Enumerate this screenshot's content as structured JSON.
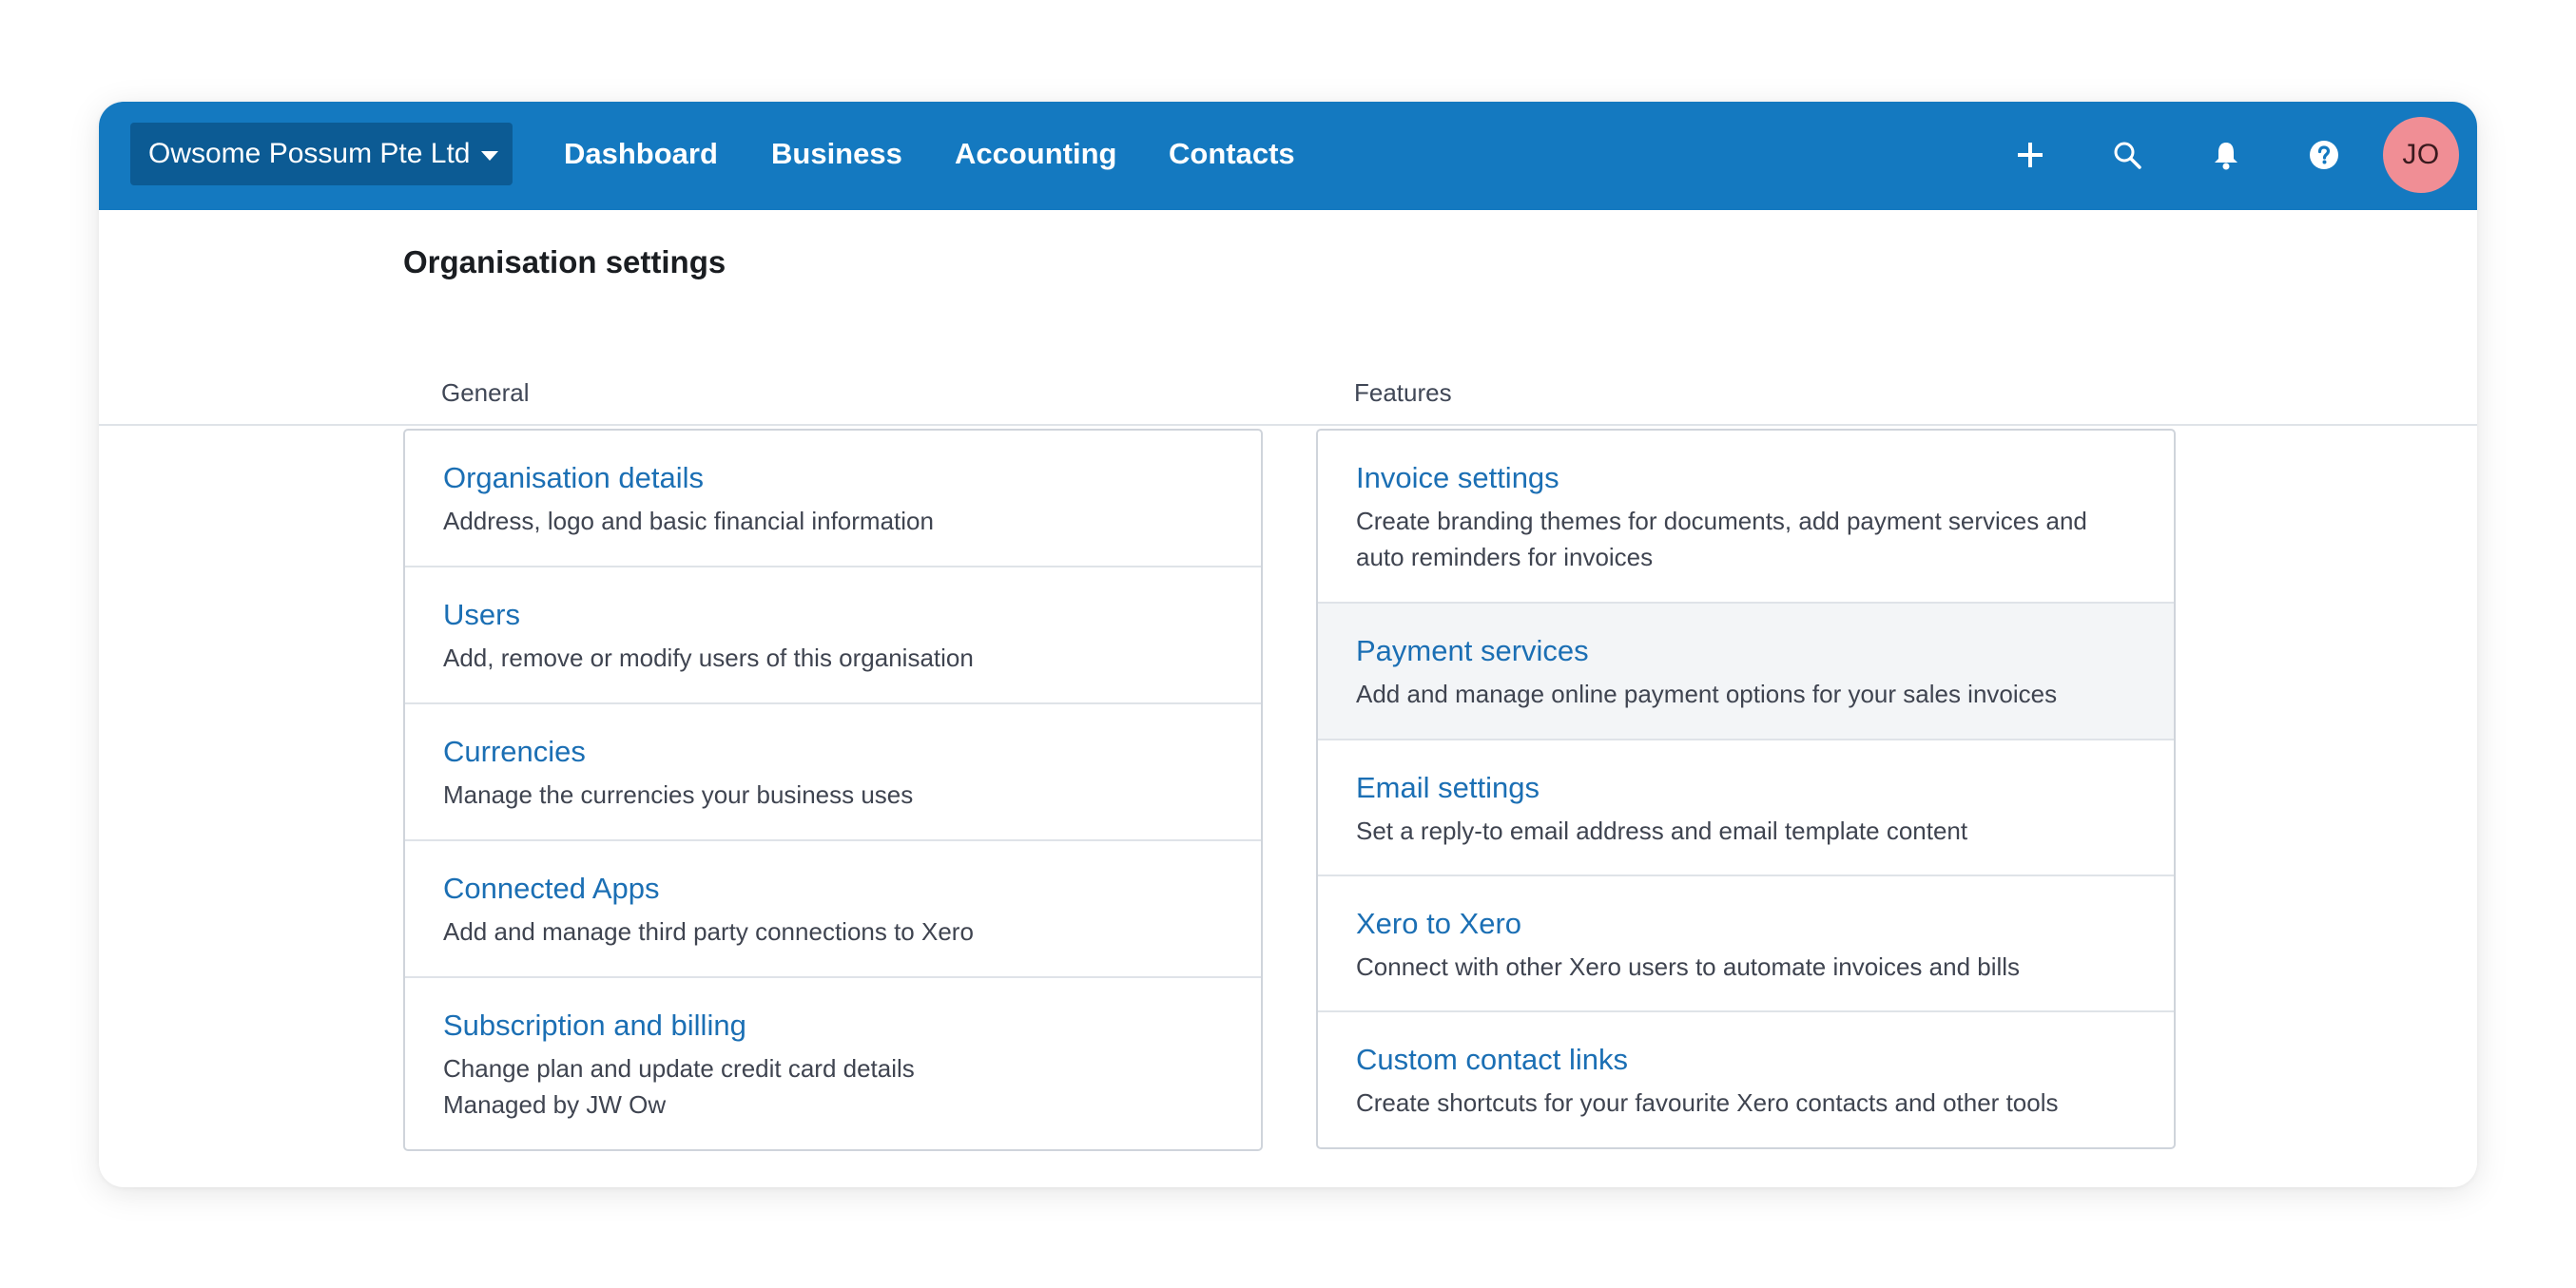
{
  "topbar": {
    "org_name": "Owsome Possum Pte Ltd",
    "nav": [
      {
        "label": "Dashboard"
      },
      {
        "label": "Business"
      },
      {
        "label": "Accounting"
      },
      {
        "label": "Contacts"
      }
    ],
    "icons": [
      "add-icon",
      "search-icon",
      "bell-icon",
      "help-icon"
    ],
    "avatar_initials": "JO",
    "avatar_color": "#f08e95",
    "bar_color": "#1479c0"
  },
  "page": {
    "title": "Organisation settings"
  },
  "general": {
    "label": "General",
    "items": [
      {
        "title": "Organisation details",
        "desc": "Address, logo and basic financial information"
      },
      {
        "title": "Users",
        "desc": "Add, remove or modify users of this organisation"
      },
      {
        "title": "Currencies",
        "desc": "Manage the currencies your business uses"
      },
      {
        "title": "Connected Apps",
        "desc": "Add and manage third party connections to Xero"
      },
      {
        "title": "Subscription and billing",
        "desc": "Change plan and update credit card details",
        "extra": "Managed by JW Ow"
      }
    ]
  },
  "features": {
    "label": "Features",
    "items": [
      {
        "title": "Invoice settings",
        "desc": "Create branding themes for documents, add payment services and auto reminders for invoices"
      },
      {
        "title": "Payment services",
        "desc": "Add and manage online payment options for your sales invoices"
      },
      {
        "title": "Email settings",
        "desc": "Set a reply-to email address and email template content"
      },
      {
        "title": "Xero to Xero",
        "desc": "Connect with other Xero users to automate invoices and bills"
      },
      {
        "title": "Custom contact links",
        "desc": "Create shortcuts for your favourite Xero contacts and other tools"
      }
    ]
  }
}
